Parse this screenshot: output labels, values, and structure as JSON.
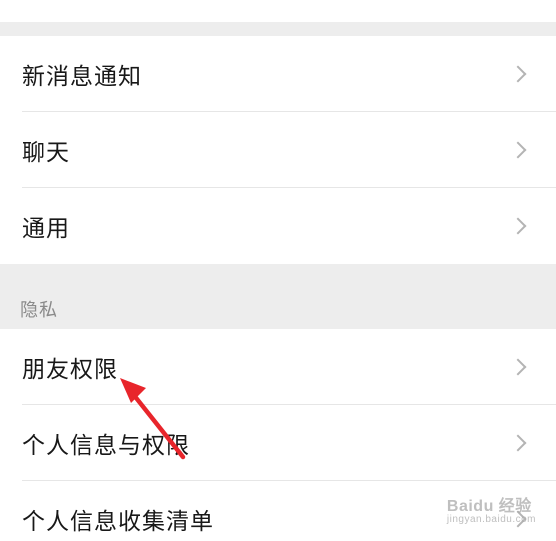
{
  "settings": {
    "group1": [
      {
        "label": "新消息通知"
      },
      {
        "label": "聊天"
      },
      {
        "label": "通用"
      }
    ],
    "privacy_header": "隐私",
    "group2": [
      {
        "label": "朋友权限"
      },
      {
        "label": "个人信息与权限"
      },
      {
        "label": "个人信息收集清单"
      }
    ]
  },
  "annotation": {
    "arrow_color": "#e8252b"
  },
  "watermark": {
    "text": "Baidu 经验",
    "sub": "jingyan.baidu.com"
  },
  "colors": {
    "background": "#ededed",
    "panel": "#ffffff",
    "text": "#181818",
    "section_text": "#8a8a8a",
    "chevron": "#b4b4b4"
  }
}
